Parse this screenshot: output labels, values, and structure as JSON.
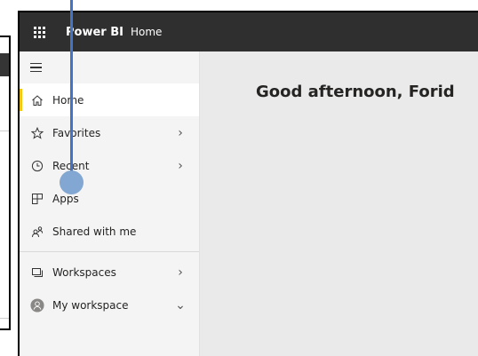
{
  "app": {
    "name": "Power BI",
    "breadcrumb": "Home"
  },
  "sidebar": {
    "items": [
      {
        "label": "Home",
        "icon": "home-icon",
        "active": true,
        "chevron": ""
      },
      {
        "label": "Favorites",
        "icon": "star-icon",
        "active": false,
        "chevron": "›"
      },
      {
        "label": "Recent",
        "icon": "clock-icon",
        "active": false,
        "chevron": "›"
      },
      {
        "label": "Apps",
        "icon": "apps-icon",
        "active": false,
        "chevron": ""
      },
      {
        "label": "Shared with me",
        "icon": "shared-icon",
        "active": false,
        "chevron": ""
      },
      {
        "label": "Workspaces",
        "icon": "workspaces-icon",
        "active": false,
        "chevron": "›"
      },
      {
        "label": "My workspace",
        "icon": "avatar-icon",
        "active": false,
        "chevron": "⌄"
      }
    ]
  },
  "main": {
    "greeting": "Good afternoon, Forid"
  },
  "colors": {
    "topbar": "#2f2f2f",
    "accent": "#f2c811",
    "pointer": "#4472c4",
    "pointer_dot": "#7aa2d0"
  }
}
